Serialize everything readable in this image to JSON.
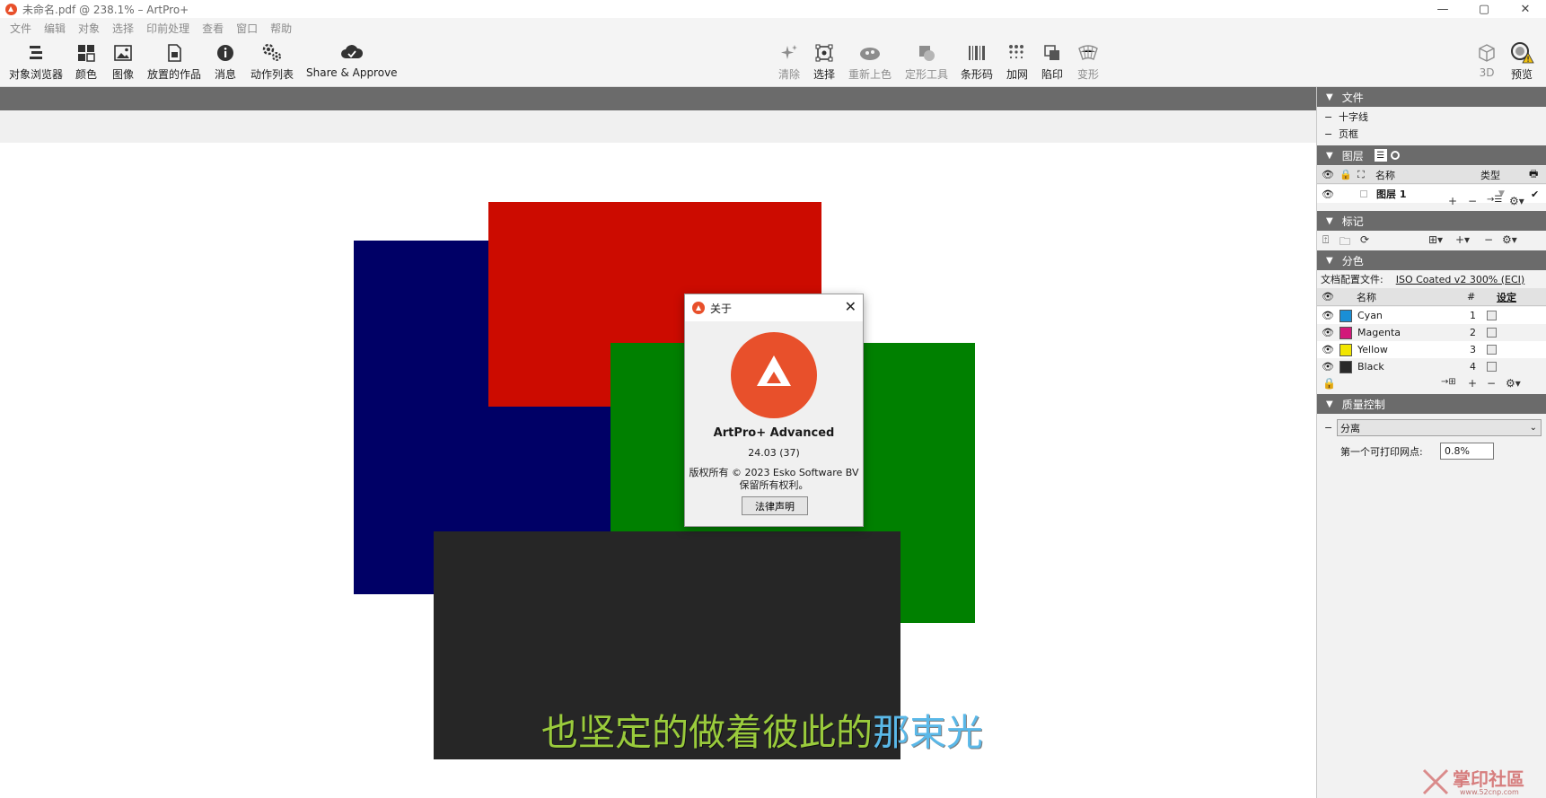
{
  "window": {
    "title": "未命名.pdf @ 238.1% – ArtPro+",
    "minimize": "—",
    "maximize": "▢",
    "close": "✕"
  },
  "menu": [
    "文件",
    "编辑",
    "对象",
    "选择",
    "印前处理",
    "查看",
    "窗口",
    "帮助"
  ],
  "toolbar": {
    "left": [
      {
        "label": "对象浏览器",
        "icon": "object-browser-icon"
      },
      {
        "label": "颜色",
        "icon": "color-grid-icon"
      },
      {
        "label": "图像",
        "icon": "image-icon"
      },
      {
        "label": "放置的作品",
        "icon": "placed-art-icon"
      },
      {
        "label": "消息",
        "icon": "info-icon"
      },
      {
        "label": "动作列表",
        "icon": "action-list-icon"
      },
      {
        "label": "Share & Approve",
        "icon": "cloud-check-icon"
      }
    ],
    "center": [
      {
        "label": "清除",
        "icon": "sparkle-icon"
      },
      {
        "label": "选择",
        "icon": "select-box-icon"
      },
      {
        "label": "重新上色",
        "icon": "recolor-icon"
      },
      {
        "label": "定形工具",
        "icon": "shape-tool-icon"
      },
      {
        "label": "条形码",
        "icon": "barcode-icon"
      },
      {
        "label": "加网",
        "icon": "screening-icon"
      },
      {
        "label": "陷印",
        "icon": "trap-icon"
      },
      {
        "label": "变形",
        "icon": "distort-icon"
      }
    ],
    "right": [
      {
        "label": "3D",
        "icon": "cube-icon"
      },
      {
        "label": "预览",
        "icon": "preview-warning-icon"
      }
    ]
  },
  "about_dialog": {
    "title": "关于",
    "product": "ArtPro+ Advanced",
    "version": "24.03 (37)",
    "copyright": "版权所有 © 2023 Esko Software BV",
    "rights": "保留所有权利。",
    "legal_button": "法律声明"
  },
  "subtitle": {
    "part1": "也坚定的做着彼此的",
    "part2": "那束光"
  },
  "panel": {
    "file": {
      "title": "文件",
      "items": [
        "十字线",
        "页框"
      ]
    },
    "layers": {
      "title": "图层",
      "col_name": "名称",
      "col_type": "类型",
      "rows": [
        {
          "name": "图层 1"
        }
      ]
    },
    "marks": {
      "title": "标记"
    },
    "separations": {
      "title": "分色",
      "profile_label": "文档配置文件:",
      "profile_value": "ISO Coated v2 300% (ECI)",
      "col_name": "名称",
      "col_num": "#",
      "col_set": "设定",
      "inks": [
        {
          "name": "Cyan",
          "num": "1",
          "color": "#1a8fd6"
        },
        {
          "name": "Magenta",
          "num": "2",
          "color": "#d2187a"
        },
        {
          "name": "Yellow",
          "num": "3",
          "color": "#f2e600"
        },
        {
          "name": "Black",
          "num": "4",
          "color": "#2a2a2a"
        }
      ]
    },
    "qc": {
      "title": "质量控制",
      "mode": "分离",
      "field_label": "第一个可打印网点:",
      "field_value": "0.8%"
    }
  },
  "colors": {
    "navy": "#000066",
    "red": "#cc0b00",
    "green": "#008000",
    "dark": "#262626",
    "accent": "#e8502b"
  },
  "watermark": {
    "text": "掌印社區",
    "url": "www.52cnp.com"
  }
}
